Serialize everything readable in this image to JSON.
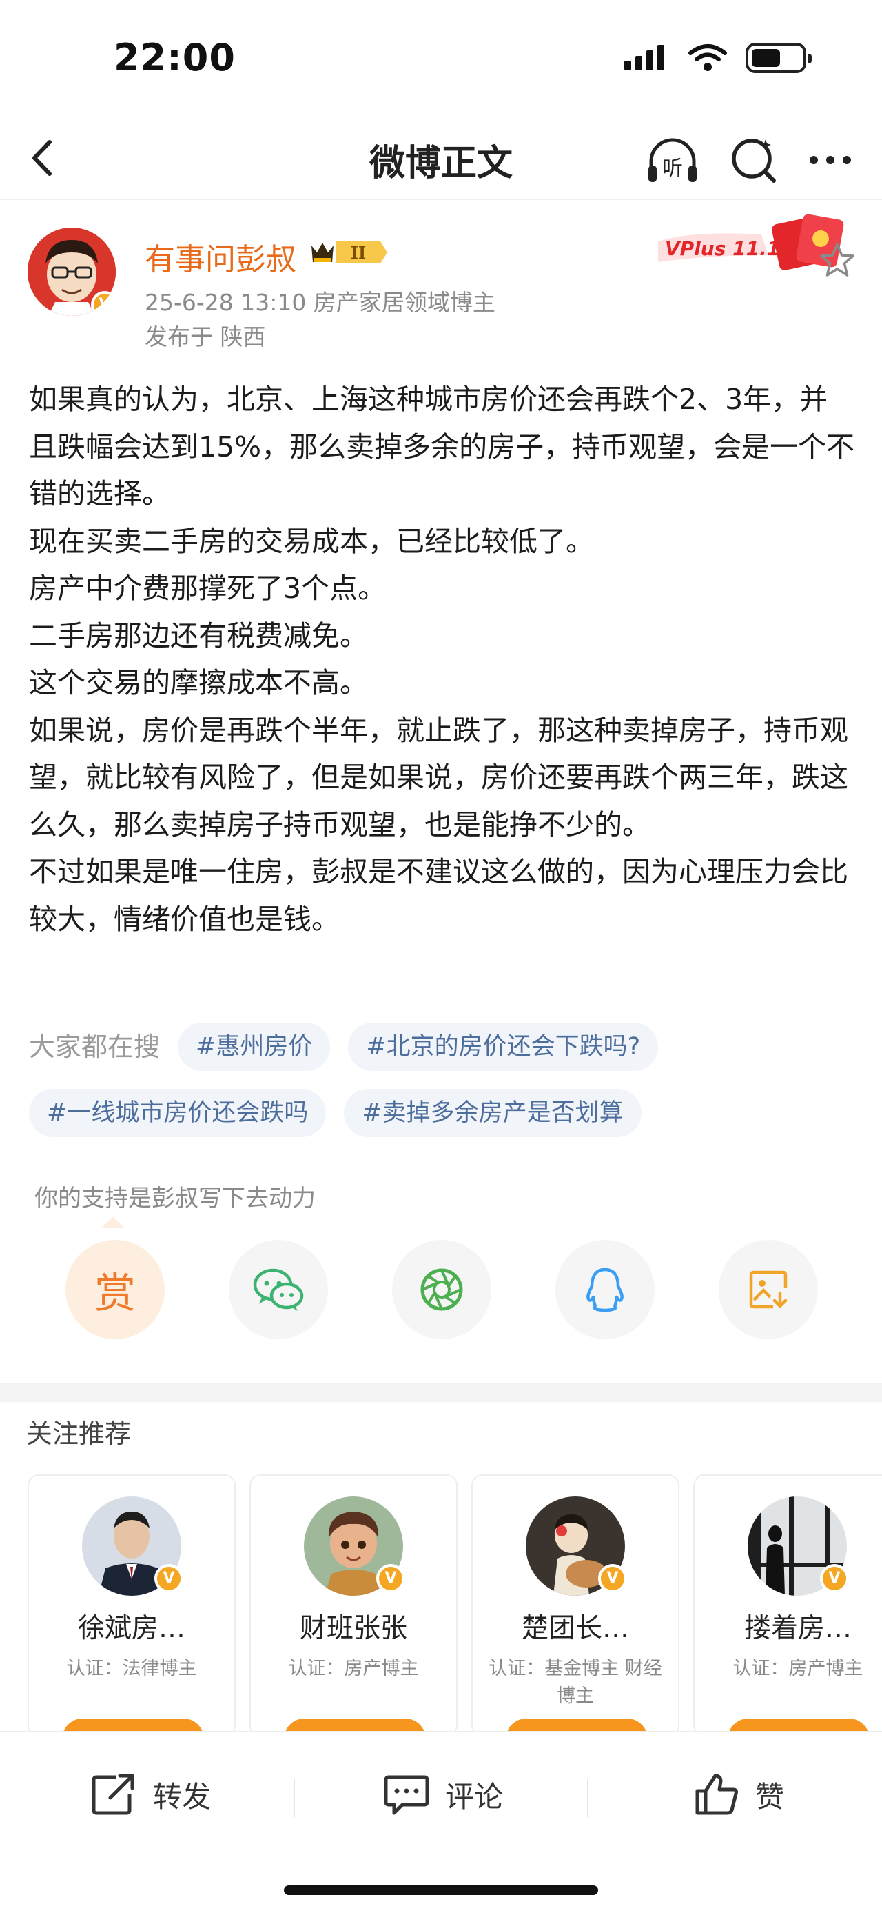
{
  "status_bar": {
    "time": "22:00"
  },
  "nav": {
    "title": "微博正文",
    "listen_label": "听"
  },
  "author": {
    "name": "有事问彭叔",
    "vip_level": "II",
    "meta": "25-6-28 13:10  房产家居领域博主",
    "location": "发布于 陕西",
    "promo": "VPlus 11.11"
  },
  "post": {
    "paragraphs": [
      "如果真的认为，北京、上海这种城市房价还会再跌个2、3年，并且跌幅会达到15%，那么卖掉多余的房子，持币观望，会是一个不错的选择。",
      "现在买卖二手房的交易成本，已经比较低了。",
      "房产中介费那撑死了3个点。",
      "二手房那边还有税费减免。",
      "这个交易的摩擦成本不高。",
      "如果说，房价是再跌个半年，就止跌了，那这种卖掉房子，持币观望，就比较有风险了，但是如果说，房价还要再跌个两三年，跌这么久，那么卖掉房子持币观望，也是能挣不少的。",
      "不过如果是唯一住房，彭叔是不建议这么做的，因为心理压力会比较大，情绪价值也是钱。"
    ]
  },
  "hot_search": {
    "label": "大家都在搜",
    "tags": [
      "#惠州房价",
      "#北京的房价还会下跌吗?",
      "#一线城市房价还会跌吗",
      "#卖掉多余房产是否划算"
    ]
  },
  "support": {
    "text": "你的支持是彭叔写下去动力",
    "reward_label": "赏"
  },
  "recommend": {
    "title": "关注推荐",
    "users": [
      {
        "name": "徐斌房…",
        "cert": "认证：法律博主"
      },
      {
        "name": "财班张张",
        "cert": "认证：房产博主"
      },
      {
        "name": "楚团长…",
        "cert": "认证：基金博主 财经博主"
      },
      {
        "name": "搂着房…",
        "cert": "认证：房产博主"
      }
    ]
  },
  "bottom_bar": {
    "repost": "转发",
    "comment": "评论",
    "like": "赞"
  },
  "colors": {
    "name_orange": "#e86a1a",
    "tag_text": "#4d6d9c",
    "tag_bg": "#f1f4f9",
    "verified_badge": "#f5a623"
  }
}
